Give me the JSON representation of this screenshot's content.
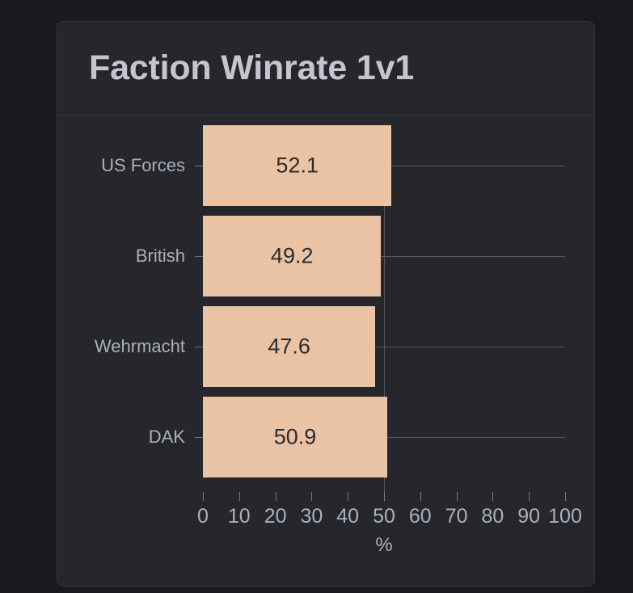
{
  "card": {
    "title": "Faction Winrate 1v1"
  },
  "colors": {
    "page_background": "#191a1e",
    "card_background": "#26272c",
    "card_border": "#33353b",
    "bar_fill": "#e9c3a3",
    "bar_value_text": "#2b2c31",
    "axis_text": "#aab0ba",
    "title_text": "#c3c6cc",
    "gridline": "#56585e"
  },
  "chart_data": {
    "type": "bar",
    "orientation": "horizontal",
    "title": "Faction Winrate 1v1",
    "categories": [
      "US Forces",
      "British",
      "Wehrmacht",
      "DAK"
    ],
    "values": [
      52.1,
      49.2,
      47.6,
      50.9
    ],
    "value_labels": [
      "52.1",
      "49.2",
      "47.6",
      "50.9"
    ],
    "xlabel": "%",
    "ylabel": "",
    "xlim": [
      0,
      100
    ],
    "xticks": [
      0,
      10,
      20,
      30,
      40,
      50,
      60,
      70,
      80,
      90,
      100
    ],
    "xtick_labels": [
      "0",
      "10",
      "20",
      "30",
      "40",
      "50",
      "60",
      "70",
      "80",
      "90",
      "100"
    ],
    "grid": true,
    "legend": false,
    "reference_line": 50
  }
}
